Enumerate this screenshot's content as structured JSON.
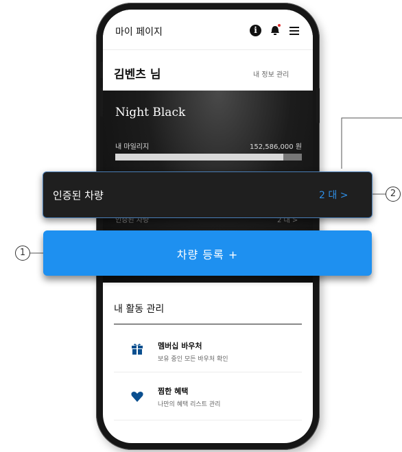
{
  "app_bar": {
    "title": "마이 페이지",
    "icons": [
      "info-icon",
      "bell-icon",
      "menu-icon"
    ]
  },
  "profile": {
    "user_name": "김벤츠 님",
    "my_info_link": "내 정보 관리"
  },
  "membership_card": {
    "grade": "Night Black",
    "mileage_label": "내 마일리지",
    "mileage_value": "152,586,000 원",
    "progress_fraction": 0.9,
    "certified_label": "인증된 차량",
    "certified_count": "2 대 >"
  },
  "callouts": {
    "certified_vehicles": {
      "label": "인증된 차량",
      "count": "2 대 >",
      "marker": "2"
    },
    "register_vehicle": {
      "label": "차량 등록 +",
      "marker": "1"
    }
  },
  "activities": {
    "title": "내 활동 관리",
    "items": [
      {
        "title": "멤버십 바우처",
        "desc": "보유 중인 모든 바우처 확인",
        "icon": "gift-icon"
      },
      {
        "title": "찜한 혜택",
        "desc": "나만의 혜택 리스트 관리",
        "icon": "heart-icon"
      }
    ]
  },
  "colors": {
    "accent_blue": "#1e90f0",
    "link_blue": "#2f8fe6",
    "card_dark": "#1c1c1c"
  }
}
